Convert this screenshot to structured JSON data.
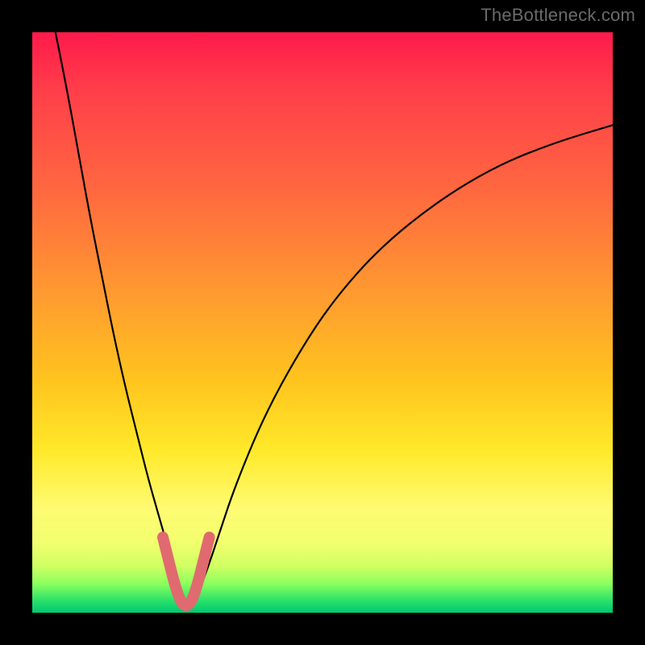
{
  "attribution": "TheBottleneck.com",
  "chart_data": {
    "type": "line",
    "title": "",
    "xlabel": "",
    "ylabel": "",
    "xlim": [
      0,
      100
    ],
    "ylim": [
      0,
      100
    ],
    "gradient_stops": [
      {
        "pos": 0,
        "color": "#ff1a4b"
      },
      {
        "pos": 10,
        "color": "#ff3e4a"
      },
      {
        "pos": 28,
        "color": "#ff6a3f"
      },
      {
        "pos": 45,
        "color": "#ff9a30"
      },
      {
        "pos": 60,
        "color": "#ffc41e"
      },
      {
        "pos": 72,
        "color": "#ffe92a"
      },
      {
        "pos": 82,
        "color": "#fffb72"
      },
      {
        "pos": 88,
        "color": "#f2ff6e"
      },
      {
        "pos": 92,
        "color": "#cfff62"
      },
      {
        "pos": 95,
        "color": "#8bff5e"
      },
      {
        "pos": 98,
        "color": "#28e06a"
      },
      {
        "pos": 100,
        "color": "#00c870"
      }
    ],
    "series": [
      {
        "name": "bottleneck-curve",
        "stroke": "#000000",
        "x": [
          4,
          6,
          8,
          10,
          12,
          14,
          16,
          18,
          20,
          22,
          24,
          25,
          26,
          27,
          28,
          30,
          32,
          35,
          40,
          46,
          52,
          60,
          70,
          80,
          90,
          100
        ],
        "y": [
          100,
          90,
          79,
          68,
          58,
          48,
          39,
          31,
          23,
          16,
          9,
          5,
          2,
          1,
          2,
          7,
          13,
          22,
          34,
          45,
          54,
          63,
          71,
          77,
          81,
          84
        ]
      },
      {
        "name": "highlight-valley",
        "stroke": "#e06a6f",
        "stroke_width": 14,
        "x": [
          22.5,
          23.5,
          24.5,
          25.5,
          26.5,
          27.5,
          28.5,
          29.5,
          30.5
        ],
        "y": [
          13,
          9,
          5,
          2,
          1,
          2,
          5,
          9,
          13
        ]
      }
    ],
    "minimum": {
      "x": 27,
      "y": 1
    }
  }
}
